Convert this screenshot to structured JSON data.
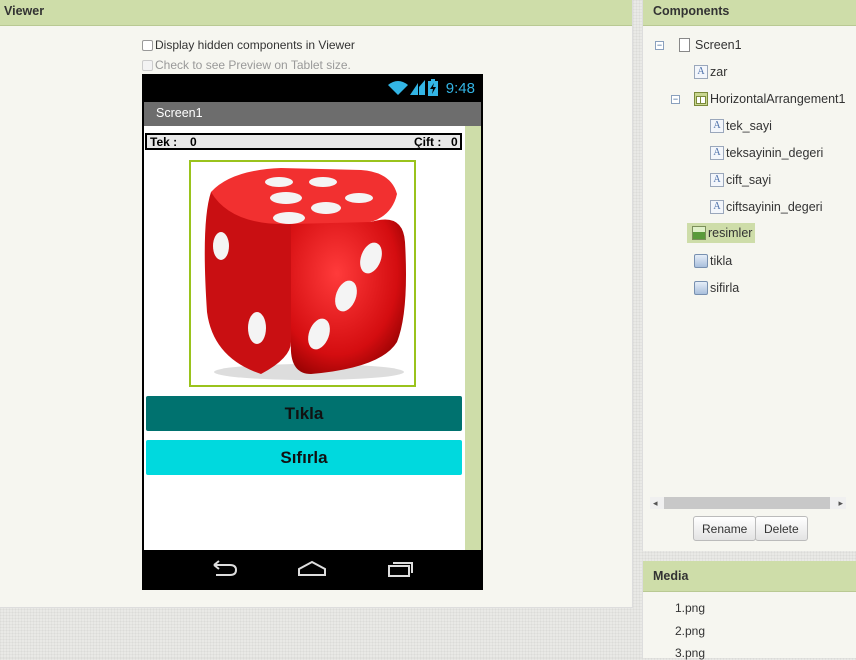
{
  "viewer": {
    "title": "Viewer",
    "display_hidden_label": "Display hidden components in Viewer",
    "tablet_preview_label": "Check to see Preview on Tablet size."
  },
  "phone": {
    "clock": "9:48",
    "screen_title": "Screen1",
    "tek_label": "Tek :",
    "tek_value": "0",
    "cift_label": "Çift :",
    "cift_value": "0",
    "button_tikla": "Tıkla",
    "button_sifirla": "Sıfırla",
    "colors": {
      "tikla_bg": "#00726f",
      "sifirla_bg": "#00d9de",
      "image_border": "#9ac31c",
      "clock": "#33b5e5"
    }
  },
  "components": {
    "title": "Components",
    "tree": [
      {
        "name": "Screen1",
        "icon": "screen-icon"
      },
      {
        "name": "zar",
        "icon": "label-icon"
      },
      {
        "name": "HorizontalArrangement1",
        "icon": "horizontal-arrangement-icon"
      },
      {
        "name": "tek_sayi",
        "icon": "label-icon"
      },
      {
        "name": "teksayinin_degeri",
        "icon": "label-icon"
      },
      {
        "name": "cift_sayi",
        "icon": "label-icon"
      },
      {
        "name": "ciftsayinin_degeri",
        "icon": "label-icon"
      },
      {
        "name": "resimler",
        "icon": "image-icon",
        "selected": true
      },
      {
        "name": "tikla",
        "icon": "button-icon"
      },
      {
        "name": "sifirla",
        "icon": "button-icon"
      }
    ],
    "rename_label": "Rename",
    "delete_label": "Delete"
  },
  "media": {
    "title": "Media",
    "files": [
      "1.png",
      "2.png",
      "3.png"
    ]
  }
}
